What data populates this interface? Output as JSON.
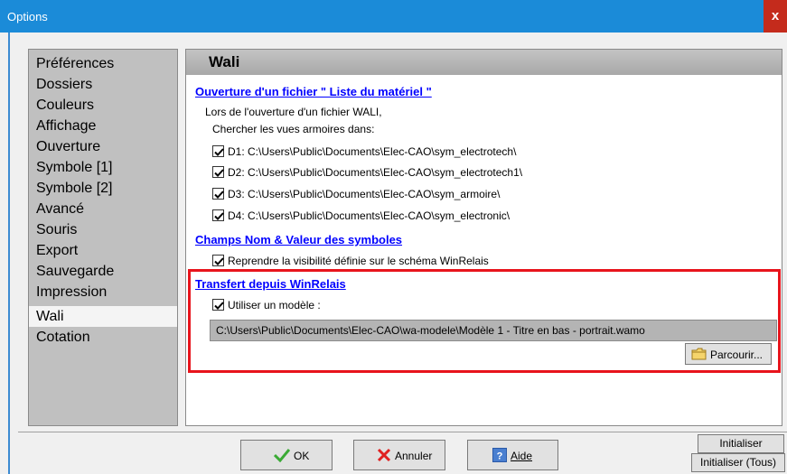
{
  "window": {
    "title": "Options",
    "close_label": "x"
  },
  "sidebar": {
    "items": [
      {
        "label": "Préférences"
      },
      {
        "label": "Dossiers"
      },
      {
        "label": "Couleurs"
      },
      {
        "label": "Affichage"
      },
      {
        "label": "Ouverture"
      },
      {
        "label": "Symbole [1]"
      },
      {
        "label": "Symbole [2]"
      },
      {
        "label": "Avancé"
      },
      {
        "label": "Souris"
      },
      {
        "label": "Export"
      },
      {
        "label": "Sauvegarde"
      },
      {
        "label": "Impression"
      },
      {
        "label": "Wali",
        "selected": true
      },
      {
        "label": "Cotation"
      }
    ]
  },
  "panel": {
    "header": "Wali",
    "section1": {
      "title": "Ouverture d'un fichier \" Liste du matériel \"",
      "line1": "Lors de l'ouverture d'un fichier WALI,",
      "line2": "Chercher les vues armoires dans:",
      "checkboxes": [
        {
          "label": "D1: C:\\Users\\Public\\Documents\\Elec-CAO\\sym_electrotech\\",
          "checked": true
        },
        {
          "label": "D2: C:\\Users\\Public\\Documents\\Elec-CAO\\sym_electrotech1\\",
          "checked": true
        },
        {
          "label": "D3: C:\\Users\\Public\\Documents\\Elec-CAO\\sym_armoire\\",
          "checked": true
        },
        {
          "label": "D4: C:\\Users\\Public\\Documents\\Elec-CAO\\sym_electronic\\",
          "checked": true
        }
      ]
    },
    "section2": {
      "title": "Champs Nom & Valeur des symboles",
      "checkbox": {
        "label": "Reprendre la visibilité définie sur le schéma WinRelais",
        "checked": true
      }
    },
    "section3": {
      "title": "Transfert depuis WinRelais",
      "checkbox": {
        "label": "Utiliser un modèle :",
        "checked": true
      },
      "path": "C:\\Users\\Public\\Documents\\Elec-CAO\\wa-modele\\Modèle 1 - Titre en bas - portrait.wamo",
      "browse_label": "Parcourir..."
    }
  },
  "footer": {
    "ok_label": "OK",
    "cancel_label": "Annuler",
    "help_label": "Aide",
    "reset_label": "Initialiser",
    "reset_all_label": "Initialiser (Tous)"
  },
  "colors": {
    "accent": "#1b8bd8",
    "link": "#0000ff",
    "highlight_frame": "#e8141c",
    "close": "#c42b1c"
  }
}
